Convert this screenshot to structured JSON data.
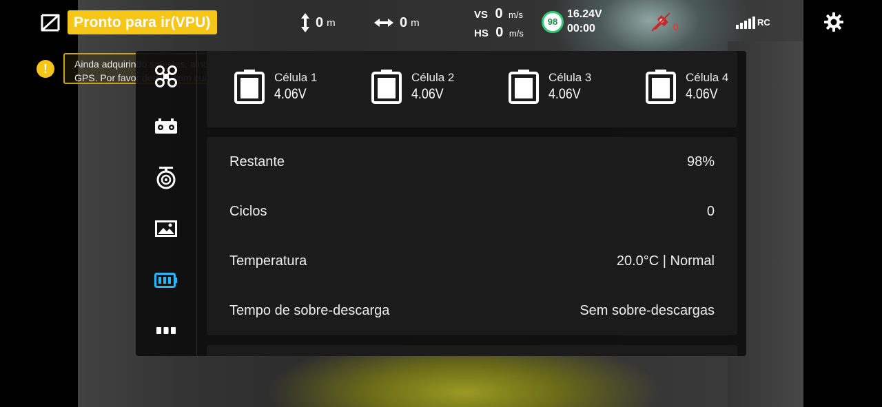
{
  "topbar": {
    "status": "Pronto para ir(VPU)",
    "altitude": {
      "value": "0",
      "unit": "m"
    },
    "distance": {
      "value": "0",
      "unit": "m"
    },
    "vertical_speed": {
      "label": "VS",
      "value": "0",
      "unit": "m/s"
    },
    "horizontal_speed": {
      "label": "HS",
      "value": "0",
      "unit": "m/s"
    },
    "battery_percent": "98",
    "battery_voltage": "16.24V",
    "flight_time": "00:00",
    "alarm_count": "0",
    "rc_label": "RC"
  },
  "warning": {
    "text": "Ainda adquirindo satélites, ainda não em modo GPS. Por favor decole com cuidado."
  },
  "side_nav": {
    "items": [
      {
        "icon": "drone-icon",
        "active": false
      },
      {
        "icon": "remote-controller-icon",
        "active": false
      },
      {
        "icon": "gimbal-camera-icon",
        "active": false
      },
      {
        "icon": "image-icon",
        "active": false
      },
      {
        "icon": "battery-icon",
        "active": true
      },
      {
        "icon": "more-icon",
        "active": false
      }
    ],
    "active_color": "#29b6f6"
  },
  "cells": [
    {
      "name": "Célula 1",
      "voltage": "4.06V"
    },
    {
      "name": "Célula 2",
      "voltage": "4.06V"
    },
    {
      "name": "Célula 3",
      "voltage": "4.06V"
    },
    {
      "name": "Célula 4",
      "voltage": "4.06V"
    }
  ],
  "battery_info": [
    {
      "label": "Restante",
      "value": "98%"
    },
    {
      "label": "Ciclos",
      "value": "0"
    },
    {
      "label": "Temperatura",
      "value": "20.0°C | Normal"
    },
    {
      "label": "Tempo de sobre-descarga",
      "value": "Sem sobre-descargas"
    }
  ],
  "colors": {
    "status_badge": "#f5c518",
    "battery_ring": "#2ecc71",
    "alarm": "#e53935"
  }
}
